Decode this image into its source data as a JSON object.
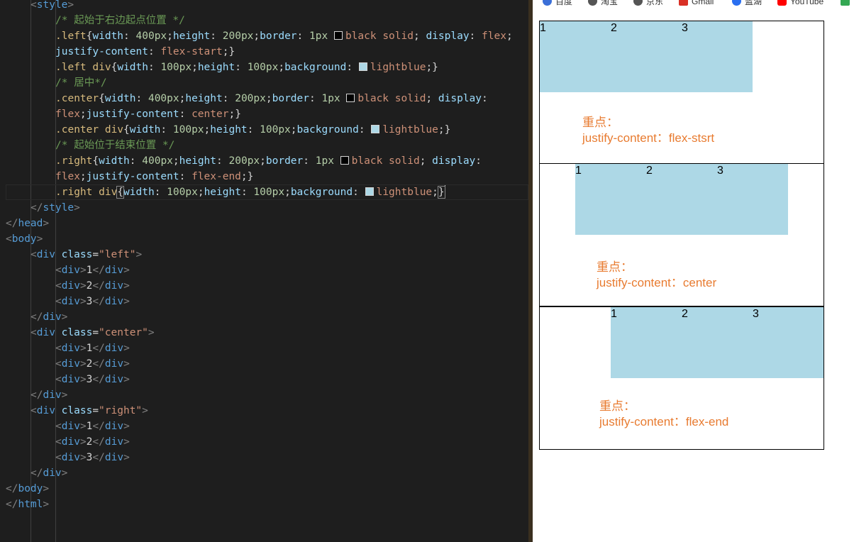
{
  "editor": {
    "lines": [
      {
        "indent": 1,
        "tokens": [
          [
            "br",
            "<"
          ],
          [
            "tag",
            "style"
          ],
          [
            "br",
            ">"
          ]
        ]
      },
      {
        "indent": 2,
        "tokens": [
          [
            "comment",
            "/* 起始于右边起点位置 */"
          ]
        ]
      },
      {
        "indent": 2,
        "tokens": [
          [
            "sel",
            ".left"
          ],
          [
            "text",
            "{"
          ],
          [
            "prop",
            "width"
          ],
          [
            "text",
            ": "
          ],
          [
            "num",
            "400px"
          ],
          [
            "text",
            ";"
          ],
          [
            "prop",
            "height"
          ],
          [
            "text",
            ": "
          ],
          [
            "num",
            "200px"
          ],
          [
            "text",
            ";"
          ],
          [
            "prop",
            "border"
          ],
          [
            "text",
            ": "
          ],
          [
            "num",
            "1px "
          ],
          [
            "swatch",
            "#000000"
          ],
          [
            "val",
            "black solid"
          ],
          [
            "text",
            "; "
          ],
          [
            "prop",
            "display"
          ],
          [
            "text",
            ": "
          ],
          [
            "val",
            "flex"
          ],
          [
            "text",
            ";"
          ]
        ]
      },
      {
        "indent": 2,
        "tokens": [
          [
            "prop",
            "justify-content"
          ],
          [
            "text",
            ": "
          ],
          [
            "val",
            "flex-start"
          ],
          [
            "text",
            ";}"
          ]
        ]
      },
      {
        "indent": 2,
        "tokens": [
          [
            "sel",
            ".left div"
          ],
          [
            "text",
            "{"
          ],
          [
            "prop",
            "width"
          ],
          [
            "text",
            ": "
          ],
          [
            "num",
            "100px"
          ],
          [
            "text",
            ";"
          ],
          [
            "prop",
            "height"
          ],
          [
            "text",
            ": "
          ],
          [
            "num",
            "100px"
          ],
          [
            "text",
            ";"
          ],
          [
            "prop",
            "background"
          ],
          [
            "text",
            ": "
          ],
          [
            "swatch",
            "#add8e6"
          ],
          [
            "val",
            "lightblue"
          ],
          [
            "text",
            ";}"
          ]
        ]
      },
      {
        "indent": 2,
        "tokens": [
          [
            "comment",
            "/* 居中*/"
          ]
        ]
      },
      {
        "indent": 2,
        "tokens": [
          [
            "sel",
            ".center"
          ],
          [
            "text",
            "{"
          ],
          [
            "prop",
            "width"
          ],
          [
            "text",
            ": "
          ],
          [
            "num",
            "400px"
          ],
          [
            "text",
            ";"
          ],
          [
            "prop",
            "height"
          ],
          [
            "text",
            ": "
          ],
          [
            "num",
            "200px"
          ],
          [
            "text",
            ";"
          ],
          [
            "prop",
            "border"
          ],
          [
            "text",
            ": "
          ],
          [
            "num",
            "1px "
          ],
          [
            "swatch",
            "#000000"
          ],
          [
            "val",
            "black solid"
          ],
          [
            "text",
            "; "
          ],
          [
            "prop",
            "display"
          ],
          [
            "text",
            ":"
          ]
        ]
      },
      {
        "indent": 2,
        "tokens": [
          [
            "val",
            "flex"
          ],
          [
            "text",
            ";"
          ],
          [
            "prop",
            "justify-content"
          ],
          [
            "text",
            ": "
          ],
          [
            "val",
            "center"
          ],
          [
            "text",
            ";}"
          ]
        ]
      },
      {
        "indent": 2,
        "tokens": [
          [
            "sel",
            ".center div"
          ],
          [
            "text",
            "{"
          ],
          [
            "prop",
            "width"
          ],
          [
            "text",
            ": "
          ],
          [
            "num",
            "100px"
          ],
          [
            "text",
            ";"
          ],
          [
            "prop",
            "height"
          ],
          [
            "text",
            ": "
          ],
          [
            "num",
            "100px"
          ],
          [
            "text",
            ";"
          ],
          [
            "prop",
            "background"
          ],
          [
            "text",
            ": "
          ],
          [
            "swatch",
            "#add8e6"
          ],
          [
            "val",
            "lightblue"
          ],
          [
            "text",
            ";}"
          ]
        ]
      },
      {
        "indent": 2,
        "tokens": [
          [
            "comment",
            "/* 起始位于结束位置 */"
          ]
        ]
      },
      {
        "indent": 2,
        "tokens": [
          [
            "sel",
            ".right"
          ],
          [
            "text",
            "{"
          ],
          [
            "prop",
            "width"
          ],
          [
            "text",
            ": "
          ],
          [
            "num",
            "400px"
          ],
          [
            "text",
            ";"
          ],
          [
            "prop",
            "height"
          ],
          [
            "text",
            ": "
          ],
          [
            "num",
            "200px"
          ],
          [
            "text",
            ";"
          ],
          [
            "prop",
            "border"
          ],
          [
            "text",
            ": "
          ],
          [
            "num",
            "1px "
          ],
          [
            "swatch",
            "#000000"
          ],
          [
            "val",
            "black solid"
          ],
          [
            "text",
            "; "
          ],
          [
            "prop",
            "display"
          ],
          [
            "text",
            ":"
          ]
        ]
      },
      {
        "indent": 2,
        "tokens": [
          [
            "val",
            "flex"
          ],
          [
            "text",
            ";"
          ],
          [
            "prop",
            "justify-content"
          ],
          [
            "text",
            ": "
          ],
          [
            "val",
            "flex-end"
          ],
          [
            "text",
            ";}"
          ]
        ]
      },
      {
        "indent": 2,
        "current": true,
        "tokens": [
          [
            "sel",
            ".right div"
          ],
          [
            "hl",
            "{"
          ],
          [
            "prop",
            "width"
          ],
          [
            "text",
            ": "
          ],
          [
            "num",
            "100px"
          ],
          [
            "text",
            ";"
          ],
          [
            "prop",
            "height"
          ],
          [
            "text",
            ": "
          ],
          [
            "num",
            "100px"
          ],
          [
            "text",
            ";"
          ],
          [
            "prop",
            "background"
          ],
          [
            "text",
            ": "
          ],
          [
            "swatch",
            "#add8e6"
          ],
          [
            "val",
            "lightblue"
          ],
          [
            "text",
            ";"
          ],
          [
            "hl",
            "}"
          ]
        ]
      },
      {
        "indent": 1,
        "tokens": [
          [
            "br",
            "</"
          ],
          [
            "tag",
            "style"
          ],
          [
            "br",
            ">"
          ]
        ]
      },
      {
        "indent": 0,
        "tokens": [
          [
            "br",
            "</"
          ],
          [
            "tag",
            "head"
          ],
          [
            "br",
            ">"
          ]
        ]
      },
      {
        "indent": 0,
        "tokens": [
          [
            "br",
            "<"
          ],
          [
            "tag",
            "body"
          ],
          [
            "br",
            ">"
          ]
        ]
      },
      {
        "indent": 1,
        "tokens": [
          [
            "br",
            "<"
          ],
          [
            "tag",
            "div "
          ],
          [
            "attr",
            "class"
          ],
          [
            "text",
            "="
          ],
          [
            "str",
            "\"left\""
          ],
          [
            "br",
            ">"
          ]
        ]
      },
      {
        "indent": 2,
        "tokens": [
          [
            "br",
            "<"
          ],
          [
            "tag",
            "div"
          ],
          [
            "br",
            ">"
          ],
          [
            "text",
            "1"
          ],
          [
            "br",
            "</"
          ],
          [
            "tag",
            "div"
          ],
          [
            "br",
            ">"
          ]
        ]
      },
      {
        "indent": 2,
        "tokens": [
          [
            "br",
            "<"
          ],
          [
            "tag",
            "div"
          ],
          [
            "br",
            ">"
          ],
          [
            "text",
            "2"
          ],
          [
            "br",
            "</"
          ],
          [
            "tag",
            "div"
          ],
          [
            "br",
            ">"
          ]
        ]
      },
      {
        "indent": 2,
        "tokens": [
          [
            "br",
            "<"
          ],
          [
            "tag",
            "div"
          ],
          [
            "br",
            ">"
          ],
          [
            "text",
            "3"
          ],
          [
            "br",
            "</"
          ],
          [
            "tag",
            "div"
          ],
          [
            "br",
            ">"
          ]
        ]
      },
      {
        "indent": 1,
        "tokens": [
          [
            "br",
            "</"
          ],
          [
            "tag",
            "div"
          ],
          [
            "br",
            ">"
          ]
        ]
      },
      {
        "indent": 1,
        "tokens": [
          [
            "br",
            "<"
          ],
          [
            "tag",
            "div "
          ],
          [
            "attr",
            "class"
          ],
          [
            "text",
            "="
          ],
          [
            "str",
            "\"center\""
          ],
          [
            "br",
            ">"
          ]
        ]
      },
      {
        "indent": 2,
        "tokens": [
          [
            "br",
            "<"
          ],
          [
            "tag",
            "div"
          ],
          [
            "br",
            ">"
          ],
          [
            "text",
            "1"
          ],
          [
            "br",
            "</"
          ],
          [
            "tag",
            "div"
          ],
          [
            "br",
            ">"
          ]
        ]
      },
      {
        "indent": 2,
        "tokens": [
          [
            "br",
            "<"
          ],
          [
            "tag",
            "div"
          ],
          [
            "br",
            ">"
          ],
          [
            "text",
            "2"
          ],
          [
            "br",
            "</"
          ],
          [
            "tag",
            "div"
          ],
          [
            "br",
            ">"
          ]
        ]
      },
      {
        "indent": 2,
        "tokens": [
          [
            "br",
            "<"
          ],
          [
            "tag",
            "div"
          ],
          [
            "br",
            ">"
          ],
          [
            "text",
            "3"
          ],
          [
            "br",
            "</"
          ],
          [
            "tag",
            "div"
          ],
          [
            "br",
            ">"
          ]
        ]
      },
      {
        "indent": 1,
        "tokens": [
          [
            "br",
            "</"
          ],
          [
            "tag",
            "div"
          ],
          [
            "br",
            ">"
          ]
        ]
      },
      {
        "indent": 1,
        "tokens": [
          [
            "br",
            "<"
          ],
          [
            "tag",
            "div "
          ],
          [
            "attr",
            "class"
          ],
          [
            "text",
            "="
          ],
          [
            "str",
            "\"right\""
          ],
          [
            "br",
            ">"
          ]
        ]
      },
      {
        "indent": 2,
        "tokens": [
          [
            "br",
            "<"
          ],
          [
            "tag",
            "div"
          ],
          [
            "br",
            ">"
          ],
          [
            "text",
            "1"
          ],
          [
            "br",
            "</"
          ],
          [
            "tag",
            "div"
          ],
          [
            "br",
            ">"
          ]
        ]
      },
      {
        "indent": 2,
        "tokens": [
          [
            "br",
            "<"
          ],
          [
            "tag",
            "div"
          ],
          [
            "br",
            ">"
          ],
          [
            "text",
            "2"
          ],
          [
            "br",
            "</"
          ],
          [
            "tag",
            "div"
          ],
          [
            "br",
            ">"
          ]
        ]
      },
      {
        "indent": 2,
        "tokens": [
          [
            "br",
            "<"
          ],
          [
            "tag",
            "div"
          ],
          [
            "br",
            ">"
          ],
          [
            "text",
            "3"
          ],
          [
            "br",
            "</"
          ],
          [
            "tag",
            "div"
          ],
          [
            "br",
            ">"
          ]
        ]
      },
      {
        "indent": 1,
        "tokens": [
          [
            "br",
            "</"
          ],
          [
            "tag",
            "div"
          ],
          [
            "br",
            ">"
          ]
        ]
      },
      {
        "indent": 0,
        "tokens": [
          [
            "br",
            "</"
          ],
          [
            "tag",
            "body"
          ],
          [
            "br",
            ">"
          ]
        ]
      },
      {
        "indent": 0,
        "tokens": [
          [
            "br",
            "</"
          ],
          [
            "tag",
            "html"
          ],
          [
            "br",
            ">"
          ]
        ]
      }
    ]
  },
  "browser": {
    "bookmarks": [
      {
        "label": "百度",
        "icon": "baidu-paw-icon",
        "color": "#3b6fd8"
      },
      {
        "label": "淘宝",
        "icon": "globe-icon",
        "color": "#555555"
      },
      {
        "label": "京东",
        "icon": "globe-icon",
        "color": "#555555"
      },
      {
        "label": "Gmail",
        "icon": "gmail-icon",
        "color": "#d93025"
      },
      {
        "label": "蓝湖",
        "icon": "lanhu-icon",
        "color": "#2a6ff0"
      },
      {
        "label": "YouTube",
        "icon": "youtube-icon",
        "color": "#ff0000"
      }
    ],
    "demos": [
      {
        "boxes": [
          "1",
          "2",
          "3"
        ],
        "note_title": "重点：",
        "note_text": "justify-content：flex-stsrt"
      },
      {
        "boxes": [
          "1",
          "2",
          "3"
        ],
        "note_title": "重点：",
        "note_text": "justify-content：center"
      },
      {
        "boxes": [
          "1",
          "2",
          "3"
        ],
        "note_title": "重点：",
        "note_text": "justify-content：flex-end"
      }
    ]
  }
}
